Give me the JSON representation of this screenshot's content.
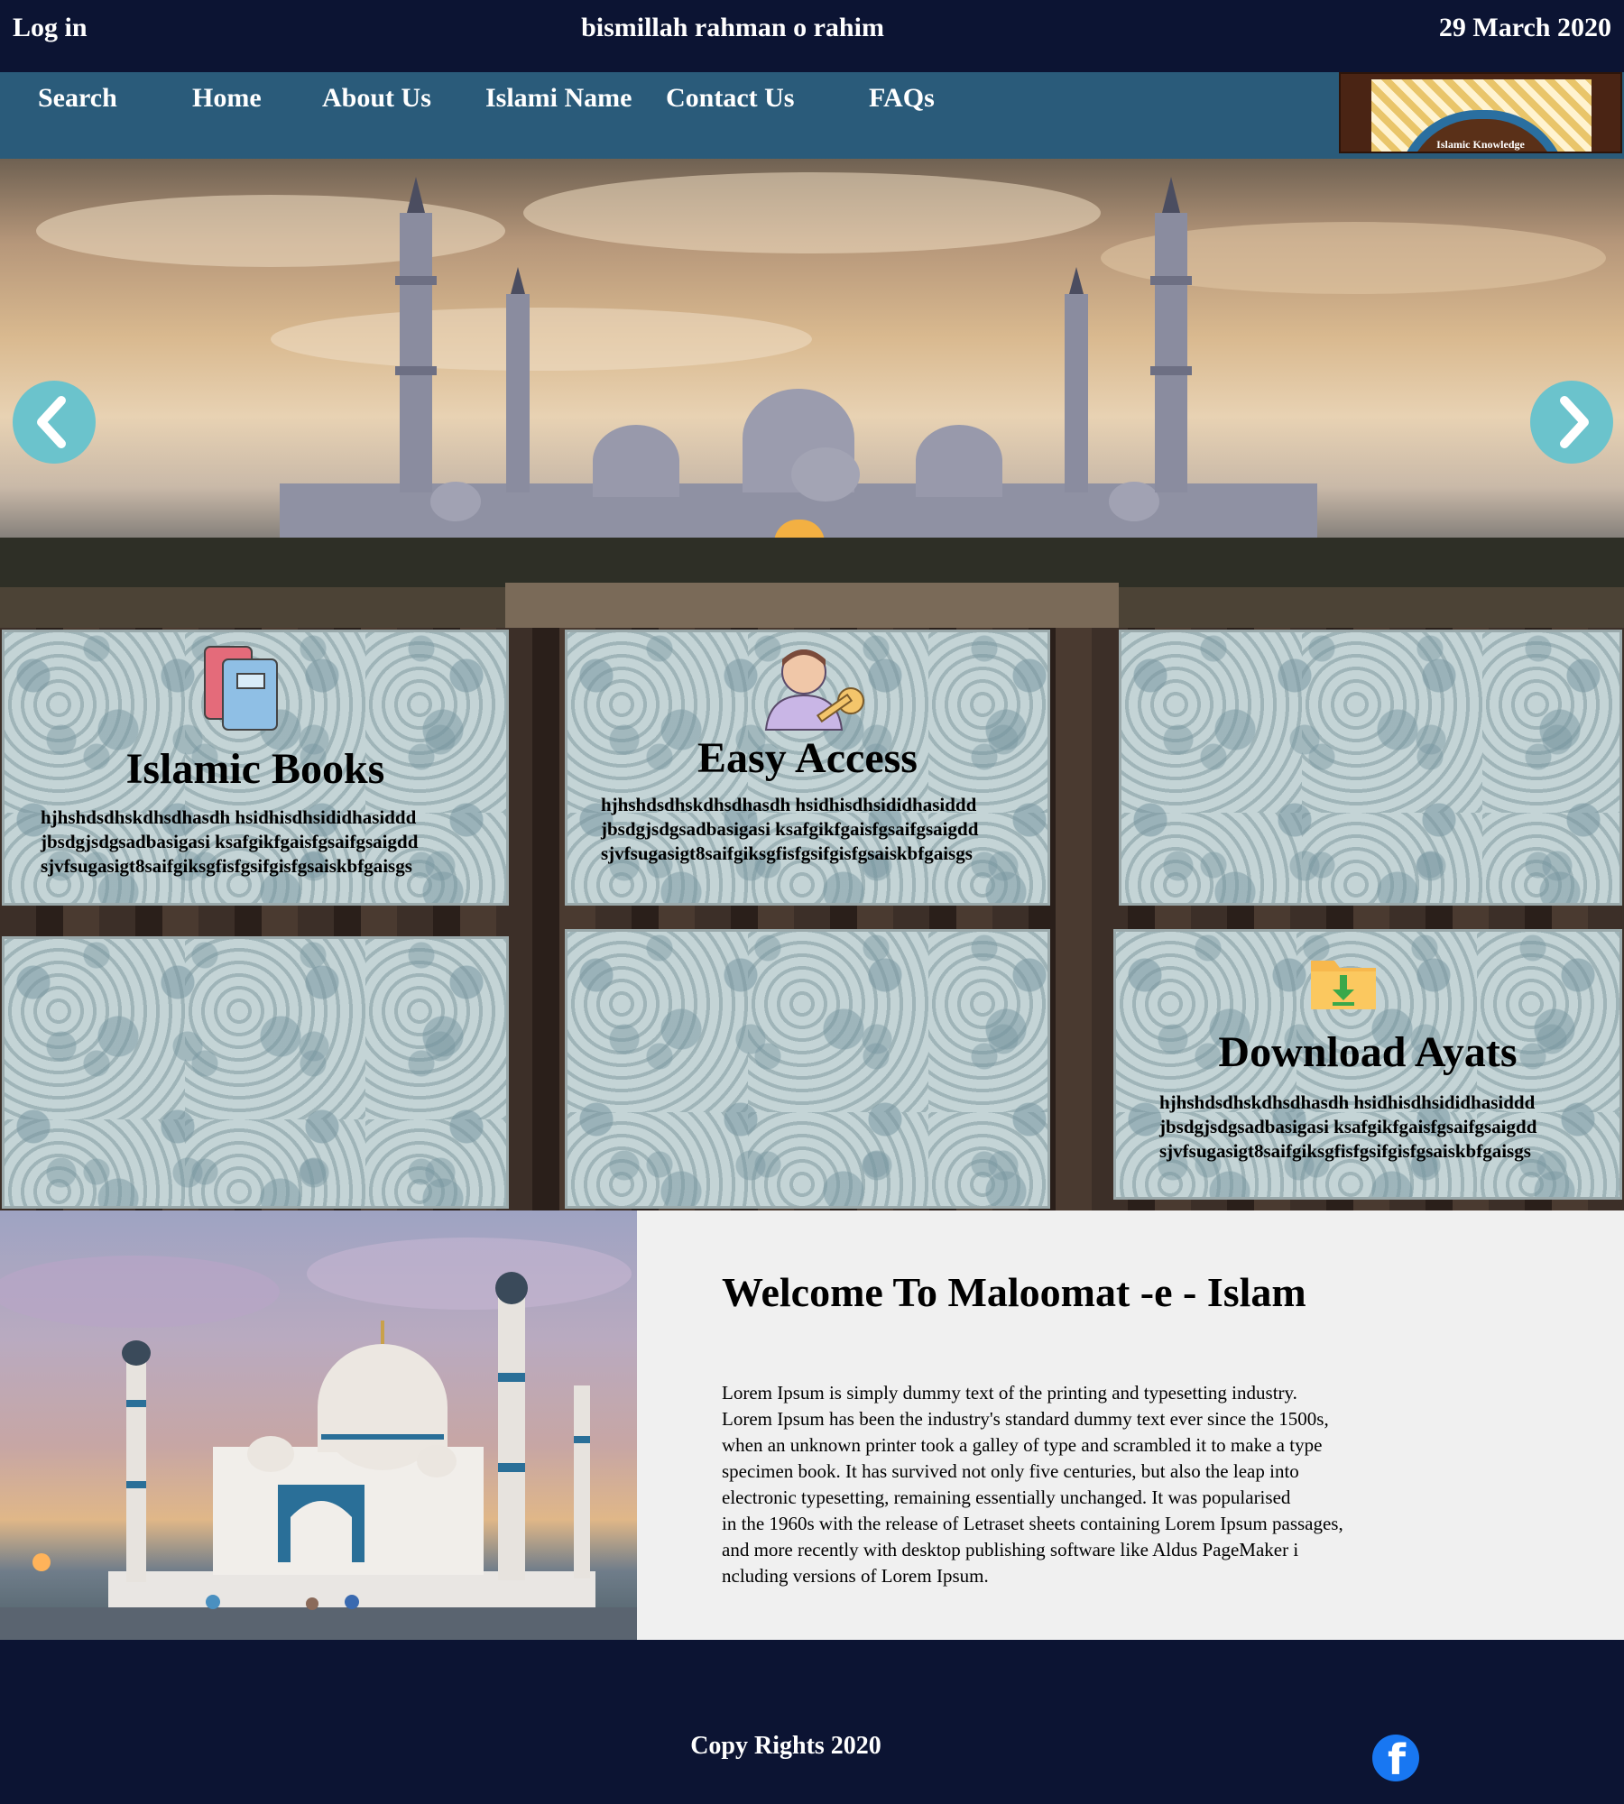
{
  "topbar": {
    "login_label": "Log in",
    "greeting": "bismillah rahman o rahim",
    "date": "29 March 2020"
  },
  "nav": {
    "items": [
      {
        "label": "Search"
      },
      {
        "label": "Home"
      },
      {
        "label": "About Us"
      },
      {
        "label": "Islami Name"
      },
      {
        "label": "Contact Us"
      },
      {
        "label": "FAQs"
      }
    ],
    "logo_text": "Islamic Knowledge"
  },
  "hero": {
    "prev_icon": "chevron-left-icon",
    "next_icon": "chevron-right-icon"
  },
  "tiles": {
    "books": {
      "icon": "books-icon",
      "title": "Islamic Books",
      "text": "hjhshdsdhskdhsdhasdh hsidhisdhsididhasiddd\njbsdgjsdgsadbasigasi ksafgikfgaisfgsaifgsaigdd\nsjvfsugasigt8saifgiksgfisfgsifgisfgsaiskbfgaisgs"
    },
    "access": {
      "icon": "user-key-icon",
      "title": "Easy Access",
      "text": "hjhshdsdhskdhsdhasdh hsidhisdhsididhasiddd\njbsdgjsdgsadbasigasi ksafgikfgaisfgsaifgsaigdd\nsjvfsugasigt8saifgiksgfisfgsifgisfgsaiskbfgaisgs"
    },
    "download": {
      "icon": "download-folder-icon",
      "title": "Download Ayats",
      "text": "hjhshdsdhskdhsdhasdh hsidhisdhsididhasiddd\njbsdgjsdgsadbasigasi ksafgikfgaisfgsaifgsaigdd\nsjvfsugasigt8saifgiksgfisfgsifgisfgsaiskbfgaisgs"
    }
  },
  "welcome": {
    "title": "Welcome To Maloomat -e - Islam",
    "body": "Lorem Ipsum is simply dummy text of the printing and typesetting industry.\nLorem Ipsum has been the industry's standard dummy text ever since the 1500s,\n when an unknown printer took a galley of type and scrambled it to make a type\n specimen book. It has survived not only five centuries, but also the leap into\nelectronic typesetting, remaining essentially unchanged. It was popularised\nin the 1960s with the release of Letraset sheets containing Lorem Ipsum passages,\n and more recently with desktop publishing software like Aldus PageMaker i\nncluding versions of Lorem Ipsum."
  },
  "footer": {
    "copyright": "Copy Rights 2020",
    "social_icon": "facebook-icon"
  },
  "colors": {
    "navy": "#0c1433",
    "nav_blue": "#2a5b7a",
    "arrow_teal": "#6bc3cc",
    "panel_gray": "#f0f0f0"
  }
}
